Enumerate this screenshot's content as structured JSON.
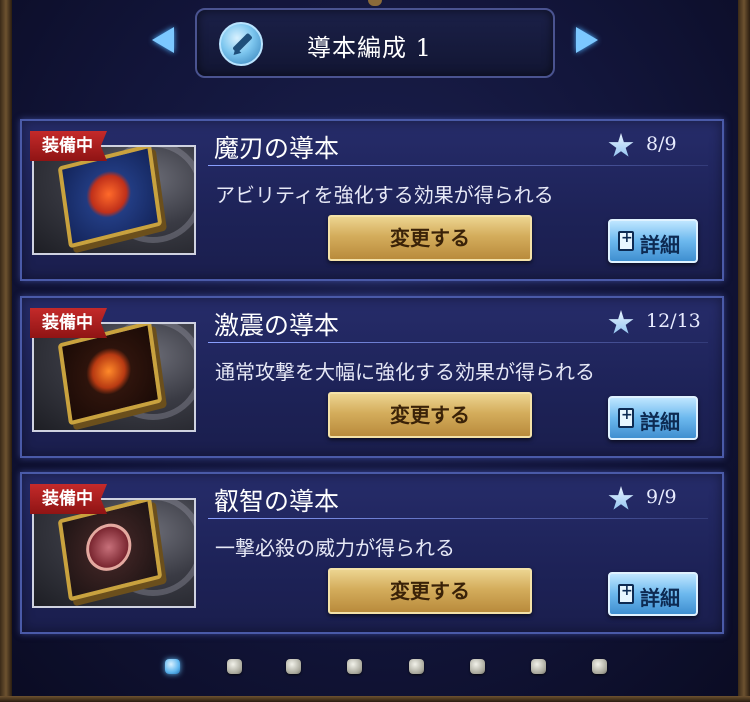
{
  "header": {
    "title": "導本編成 1",
    "icon": "pencil-edit-icon"
  },
  "cards": [
    {
      "badge": "装備中",
      "name": "魔刃の導本",
      "rank": "8/9",
      "description": "アビリティを強化する効果が得られる",
      "change_label": "変更する",
      "detail_label": "詳細"
    },
    {
      "badge": "装備中",
      "name": "激震の導本",
      "rank": "12/13",
      "description": "通常攻撃を大幅に強化する効果が得られる",
      "change_label": "変更する",
      "detail_label": "詳細"
    },
    {
      "badge": "装備中",
      "name": "叡智の導本",
      "rank": "9/9",
      "description": "一撃必殺の威力が得られる",
      "change_label": "変更する",
      "detail_label": "詳細"
    }
  ],
  "pagination": {
    "total": 8,
    "active_index": 0
  },
  "colors": {
    "badge_red": "#c42a2a",
    "detail_blue": "#6cb8ee",
    "change_gold": "#d4ad5c",
    "card_border": "#4a5aa8"
  }
}
